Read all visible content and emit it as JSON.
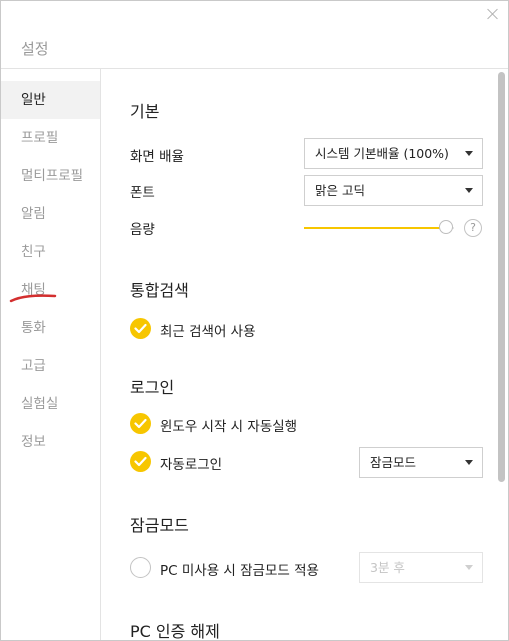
{
  "window": {
    "title": "설정"
  },
  "sidebar": {
    "items": [
      {
        "label": "일반",
        "active": true
      },
      {
        "label": "프로필"
      },
      {
        "label": "멀티프로필"
      },
      {
        "label": "알림"
      },
      {
        "label": "친구"
      },
      {
        "label": "채팅"
      },
      {
        "label": "통화"
      },
      {
        "label": "고급"
      },
      {
        "label": "실험실"
      },
      {
        "label": "정보"
      }
    ]
  },
  "basic": {
    "title": "기본",
    "scale_label": "화면 배율",
    "scale_value": "시스템 기본배율 (100%)",
    "font_label": "폰트",
    "font_value": "맑은 고딕",
    "volume_label": "음량",
    "volume_level": 1.0,
    "help_symbol": "?"
  },
  "search": {
    "title": "통합검색",
    "recent_label": "최근 검색어 사용",
    "recent_checked": true
  },
  "login": {
    "title": "로그인",
    "autostart_label": "윈도우 시작 시 자동실행",
    "autostart_checked": true,
    "autologin_label": "자동로그인",
    "autologin_checked": true,
    "autologin_mode": "잠금모드"
  },
  "lock": {
    "title": "잠금모드",
    "idle_label": "PC 미사용 시 잠금모드 적용",
    "idle_checked": false,
    "idle_value": "3분 후"
  },
  "pc_auth": {
    "title": "PC 인증 해제"
  },
  "colors": {
    "accent": "#f7c600",
    "annotation": "#d32f2f"
  },
  "icons": {
    "close": "close-icon",
    "check": "check-icon",
    "caret": "chevron-down-icon",
    "help": "help-icon"
  }
}
